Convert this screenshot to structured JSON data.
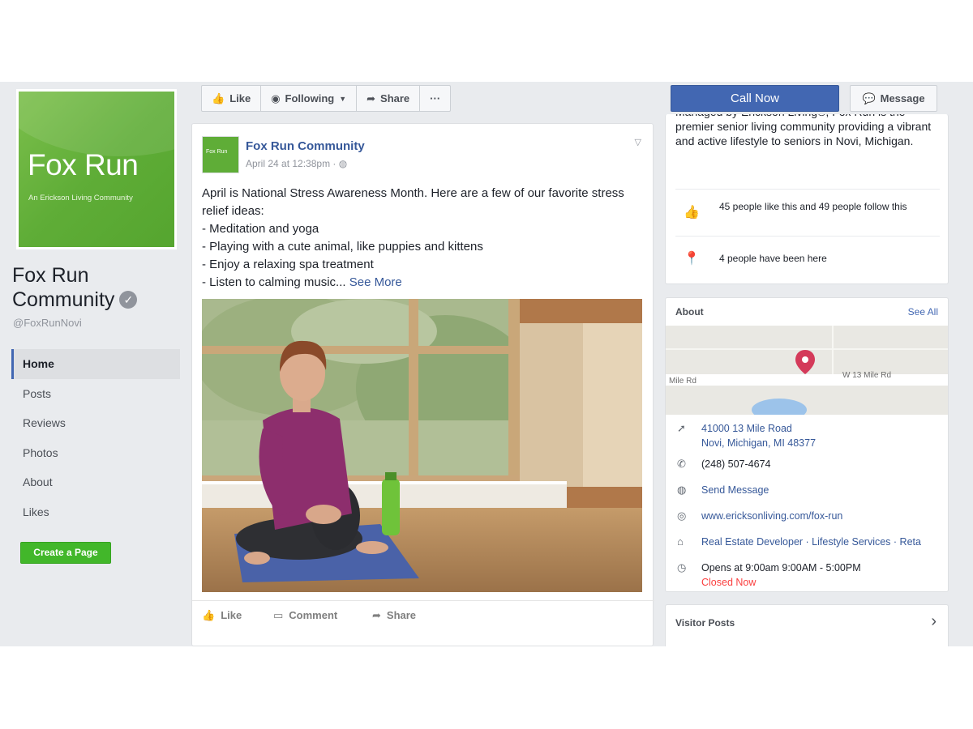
{
  "page": {
    "logo_title": "Fox Run",
    "logo_subtitle": "An Erickson Living Community",
    "name": "Fox Run Community",
    "handle": "@FoxRunNovi"
  },
  "left_nav": {
    "items": [
      {
        "label": "Home",
        "active": true
      },
      {
        "label": "Posts"
      },
      {
        "label": "Reviews"
      },
      {
        "label": "Photos"
      },
      {
        "label": "About"
      },
      {
        "label": "Likes"
      }
    ],
    "create_page_label": "Create a Page"
  },
  "action_bar": {
    "like_label": "Like",
    "following_label": "Following",
    "share_label": "Share",
    "more_label": "···"
  },
  "post": {
    "author": "Fox Run Community",
    "timestamp": "April 24 at 12:38pm",
    "privacy_icon": "globe-icon",
    "lines": [
      "April is National Stress Awareness Month. Here are a few of our favorite stress relief ideas:",
      "- Meditation and yoga",
      "- Playing with a cute animal, like puppies and kittens",
      "- Enjoy a relaxing spa treatment",
      "- Listen to calming music..."
    ],
    "see_more": "See More",
    "actions": {
      "like": "Like",
      "comment": "Comment",
      "share": "Share"
    }
  },
  "right": {
    "call_now": "Call Now",
    "message": "Message",
    "description": "Managed by Erickson Living®, Fox Run is the premier senior living community providing a vibrant and active lifestyle to seniors in Novi, Michigan.",
    "likes_follows": "45 people like this and 49 people follow this",
    "been_here": "4 people have been here",
    "about_title": "About",
    "see_all": "See All",
    "map_road_left": "Mile Rd",
    "map_road_right": "W 13 Mile Rd",
    "address_line1": "41000 13 Mile Road",
    "address_line2": "Novi, Michigan, MI 48377",
    "phone": "(248) 507-4674",
    "send_message": "Send Message",
    "website": "www.ericksonliving.com/fox-run",
    "categories": "Real Estate Developer · Lifestyle Services · Reta",
    "hours": "Opens at 9:00am 9:00AM - 5:00PM",
    "closed_now": "Closed Now",
    "visitor_posts": "Visitor Posts"
  },
  "colors": {
    "facebook_blue": "#4267b2",
    "link_blue": "#365899",
    "brand_green": "#5fad37",
    "closed_red": "#fa3e3e"
  }
}
